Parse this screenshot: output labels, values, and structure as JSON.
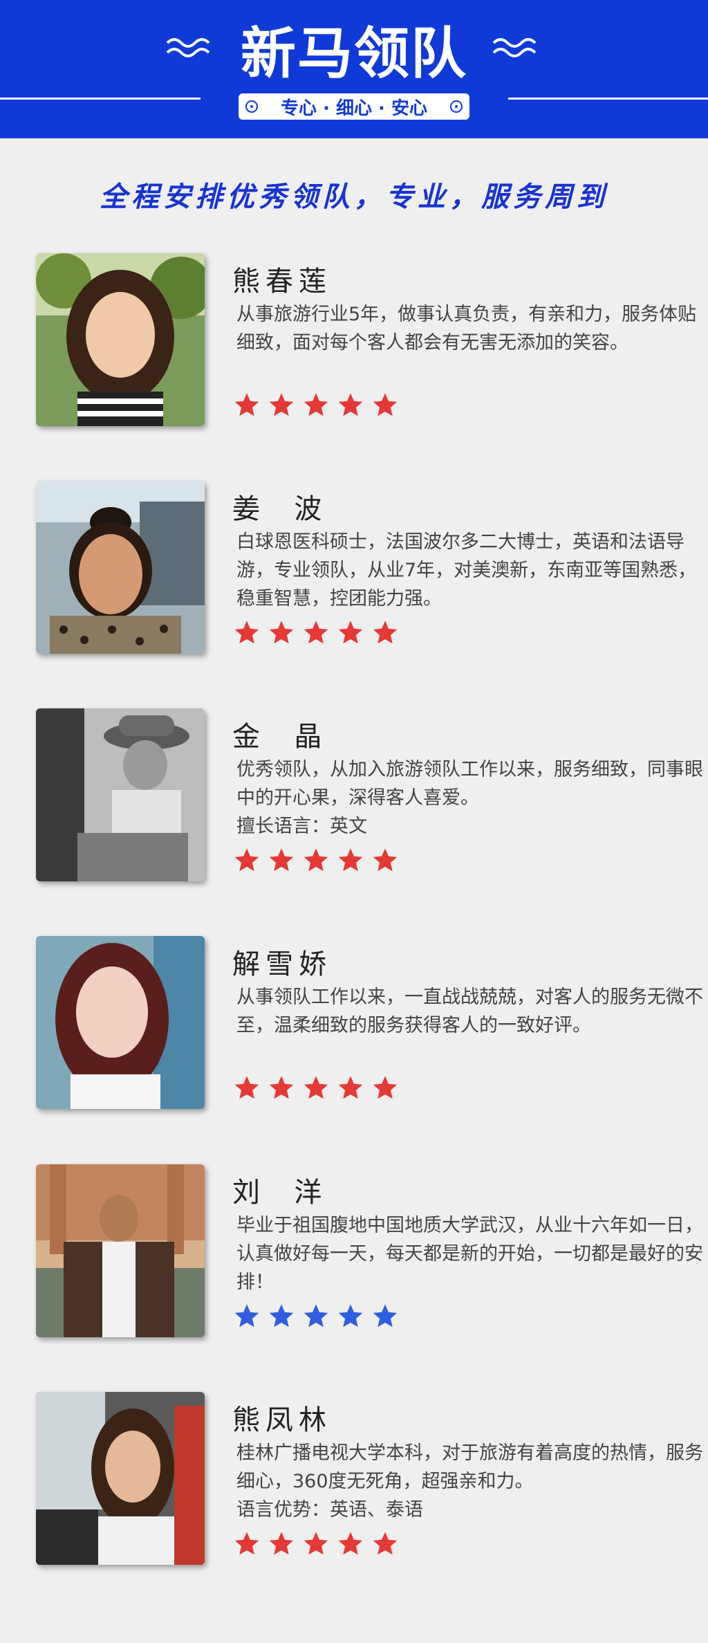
{
  "header": {
    "title": "新马领队",
    "tagline": "专心 · 细心 · 安心",
    "brand_color": "#0f3ad8"
  },
  "subtitle": "全程安排优秀领队，专业，服务周到",
  "leaders": [
    {
      "name": "熊春莲",
      "desc": "从事旅游行业5年，做事认真负责，有亲和力，服务体贴细致，面对每个客人都会有无害无添加的笑容。",
      "rating": 5,
      "star_color": "#e53935"
    },
    {
      "name": "姜  波",
      "desc": "白球恩医科硕士，法国波尔多二大博士，英语和法语导游，专业领队，从业7年，对美澳新，东南亚等国熟悉，稳重智慧，控团能力强。",
      "rating": 5,
      "star_color": "#e53935"
    },
    {
      "name": "金  晶",
      "desc": "优秀领队，从加入旅游领队工作以来，服务细致，同事眼中的开心果，深得客人喜爱。",
      "extra": "擅长语言：英文",
      "rating": 5,
      "star_color": "#e53935"
    },
    {
      "name": "解雪娇",
      "desc": "从事领队工作以来，一直战战兢兢，对客人的服务无微不至，温柔细致的服务获得客人的一致好评。",
      "rating": 5,
      "star_color": "#e53935"
    },
    {
      "name": "刘  洋",
      "desc": "毕业于祖国腹地中国地质大学武汉，从业十六年如一日，认真做好每一天，每天都是新的开始，一切都是最好的安排！",
      "rating": 5,
      "star_color": "#2f5fe0"
    },
    {
      "name": "熊凤林",
      "desc": "桂林广播电视大学本科，对于旅游有着高度的热情，服务细心，360度无死角，超强亲和力。",
      "extra": "语言优势：英语、泰语",
      "rating": 5,
      "star_color": "#e53935"
    }
  ]
}
